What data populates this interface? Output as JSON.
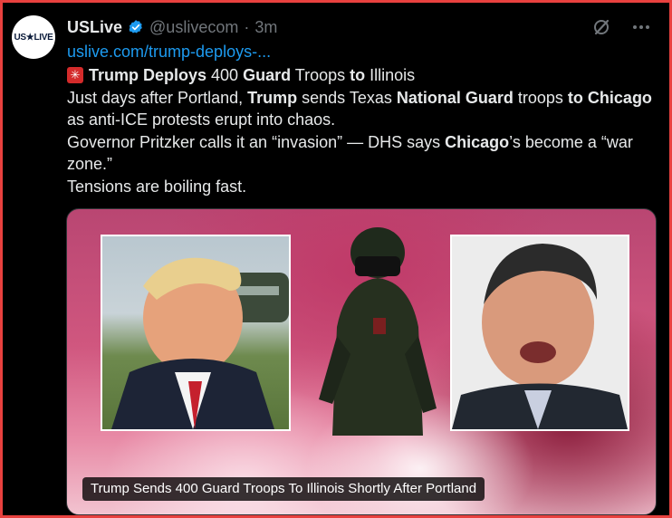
{
  "account": {
    "avatar_text": "US★LIVE",
    "name": "USLive",
    "handle": "@uslivecom",
    "separator": "·",
    "time": "3m"
  },
  "icons": {
    "verified": "verified-badge-icon",
    "grok": "grok-icon",
    "more": "more-icon",
    "siren": "rotating-light-icon"
  },
  "post": {
    "link": "uslive.com/trump-deploys-...",
    "headline_parts": [
      "Trump Deploys",
      " 400 ",
      "Guard",
      " Troops ",
      "to",
      " Illinois"
    ],
    "line2_parts": [
      "Just days after Portland, ",
      "Trump",
      " sends Texas ",
      "National Guard",
      " troops ",
      "to",
      " ",
      "Chicago",
      " as anti-ICE protests erupt into chaos."
    ],
    "line3_parts": [
      "Governor Pritzker calls it an “invasion” — DHS says ",
      "Chicago",
      "’s become a “war zone.”"
    ],
    "line4": "Tensions are boiling fast."
  },
  "media": {
    "caption": "Trump Sends 400 Guard Troops To Illinois Shortly After Portland"
  },
  "colors": {
    "frame_border": "#e8413f",
    "link": "#1d9bf0",
    "verified": "#1d9bf0",
    "text": "#e7e9ea",
    "muted": "#71767b"
  }
}
